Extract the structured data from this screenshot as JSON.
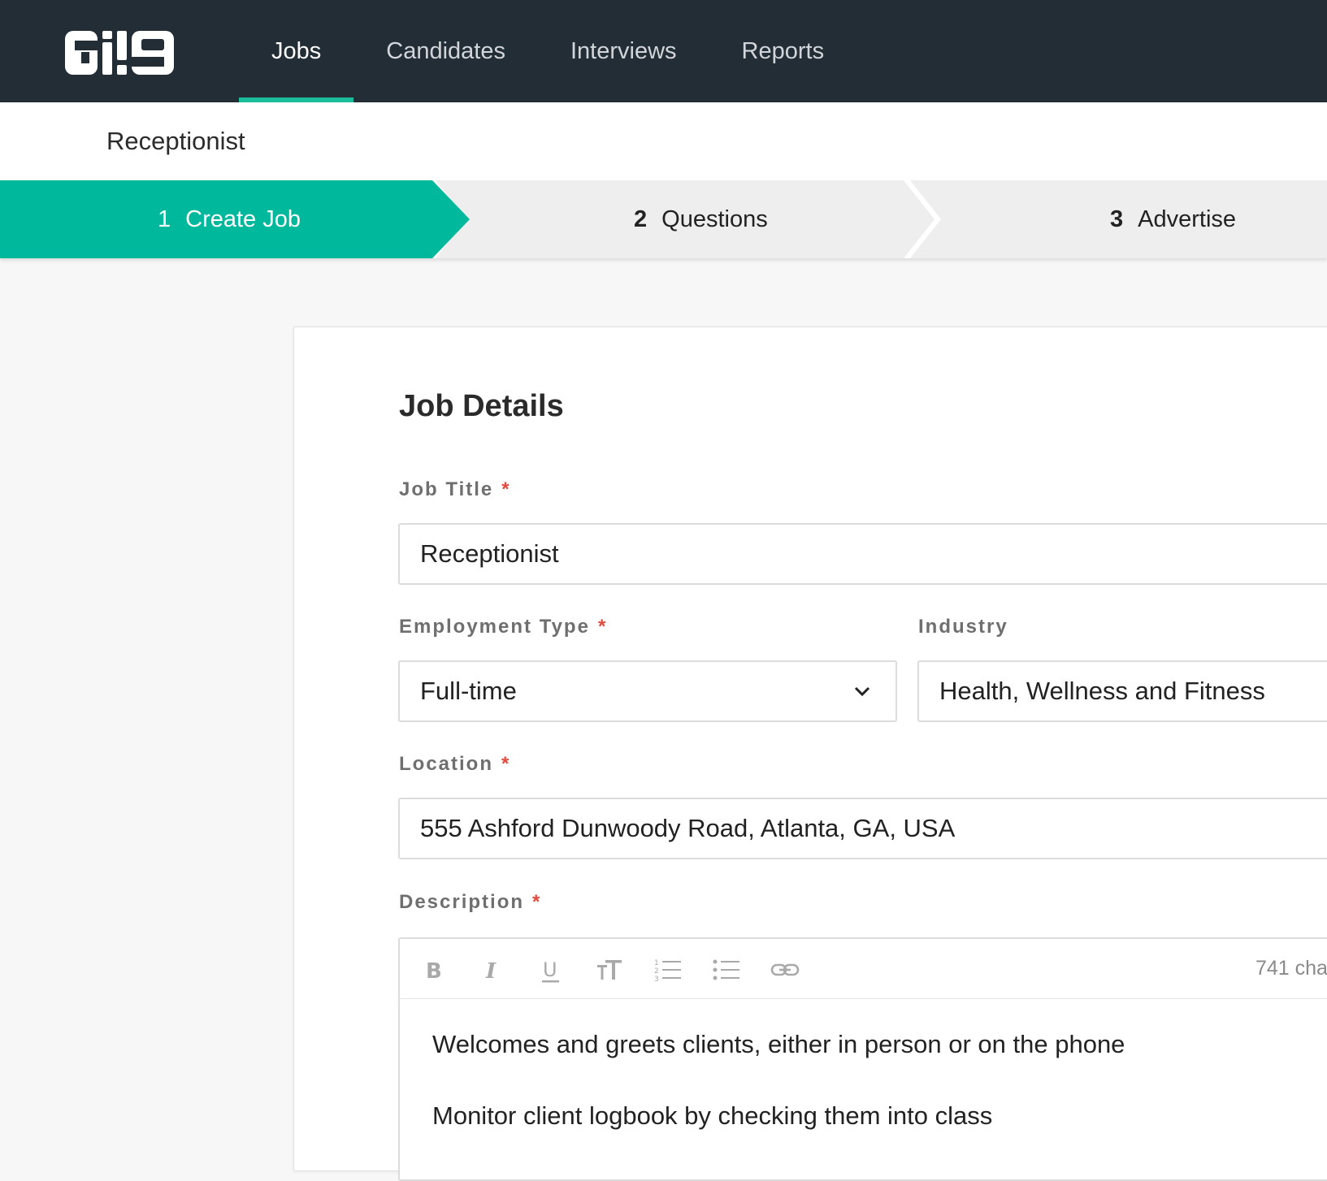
{
  "app": {
    "logo_text": "Gi!9"
  },
  "nav": {
    "items": [
      {
        "label": "Jobs",
        "active": true
      },
      {
        "label": "Candidates",
        "active": false
      },
      {
        "label": "Interviews",
        "active": false
      },
      {
        "label": "Reports",
        "active": false
      }
    ]
  },
  "page": {
    "title": "Receptionist"
  },
  "steps": [
    {
      "number": "1",
      "label": "Create Job",
      "state": "active"
    },
    {
      "number": "2",
      "label": "Questions",
      "state": "upcoming"
    },
    {
      "number": "3",
      "label": "Advertise",
      "state": "upcoming"
    }
  ],
  "form": {
    "section_title": "Job Details",
    "required_marker": "*",
    "job_title": {
      "label": "Job Title",
      "value": "Receptionist"
    },
    "employment_type": {
      "label": "Employment Type",
      "value": "Full-time"
    },
    "industry": {
      "label": "Industry",
      "value": "Health, Wellness and Fitness"
    },
    "location": {
      "label": "Location",
      "value": "555 Ashford Dunwoody Road, Atlanta, GA, USA"
    },
    "description": {
      "label": "Description",
      "char_count": "741 cha",
      "toolbar": [
        "bold-icon",
        "italic-icon",
        "underline-icon",
        "text-size-icon",
        "ordered-list-icon",
        "bullet-list-icon",
        "link-icon"
      ],
      "paragraphs": [
        "Welcomes and greets clients, either in person or on the phone",
        "Monitor client logbook by checking them into class"
      ]
    }
  },
  "colors": {
    "topbar": "#232d35",
    "accent": "#1abc9c",
    "step_inactive": "#eeeeee",
    "required": "#e5493a"
  }
}
